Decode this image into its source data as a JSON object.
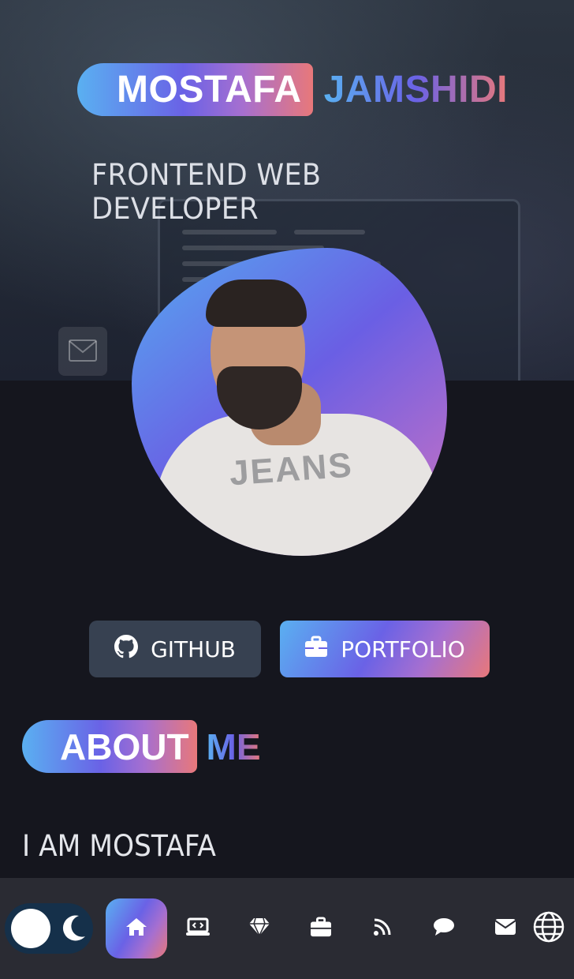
{
  "hero": {
    "name_first": "MOSTAFA",
    "name_last": "JAMSHIDI",
    "role": "FRONTEND WEB DEVELOPER"
  },
  "buttons": {
    "github_label": "GITHUB",
    "portfolio_label": "PORTFOLIO"
  },
  "about": {
    "title_first": "ABOUT",
    "title_second": "ME",
    "intro": "I AM MOSTAFA"
  },
  "bottom_nav": {
    "theme": "dark",
    "items": [
      {
        "icon": "home-icon",
        "active": true
      },
      {
        "icon": "code-laptop-icon",
        "active": false
      },
      {
        "icon": "gem-icon",
        "active": false
      },
      {
        "icon": "briefcase-icon",
        "active": false
      },
      {
        "icon": "rss-icon",
        "active": false
      },
      {
        "icon": "chat-bubble-icon",
        "active": false
      },
      {
        "icon": "envelope-icon",
        "active": false
      },
      {
        "icon": "globe-icon",
        "active": false
      }
    ]
  },
  "colors": {
    "accent_gradient": [
      "#5ab0f1",
      "#6a62e6",
      "#a66fd0",
      "#e8787a"
    ],
    "background": "#15161e",
    "nav_background": "#2a2b33",
    "github_button": "#374151"
  }
}
